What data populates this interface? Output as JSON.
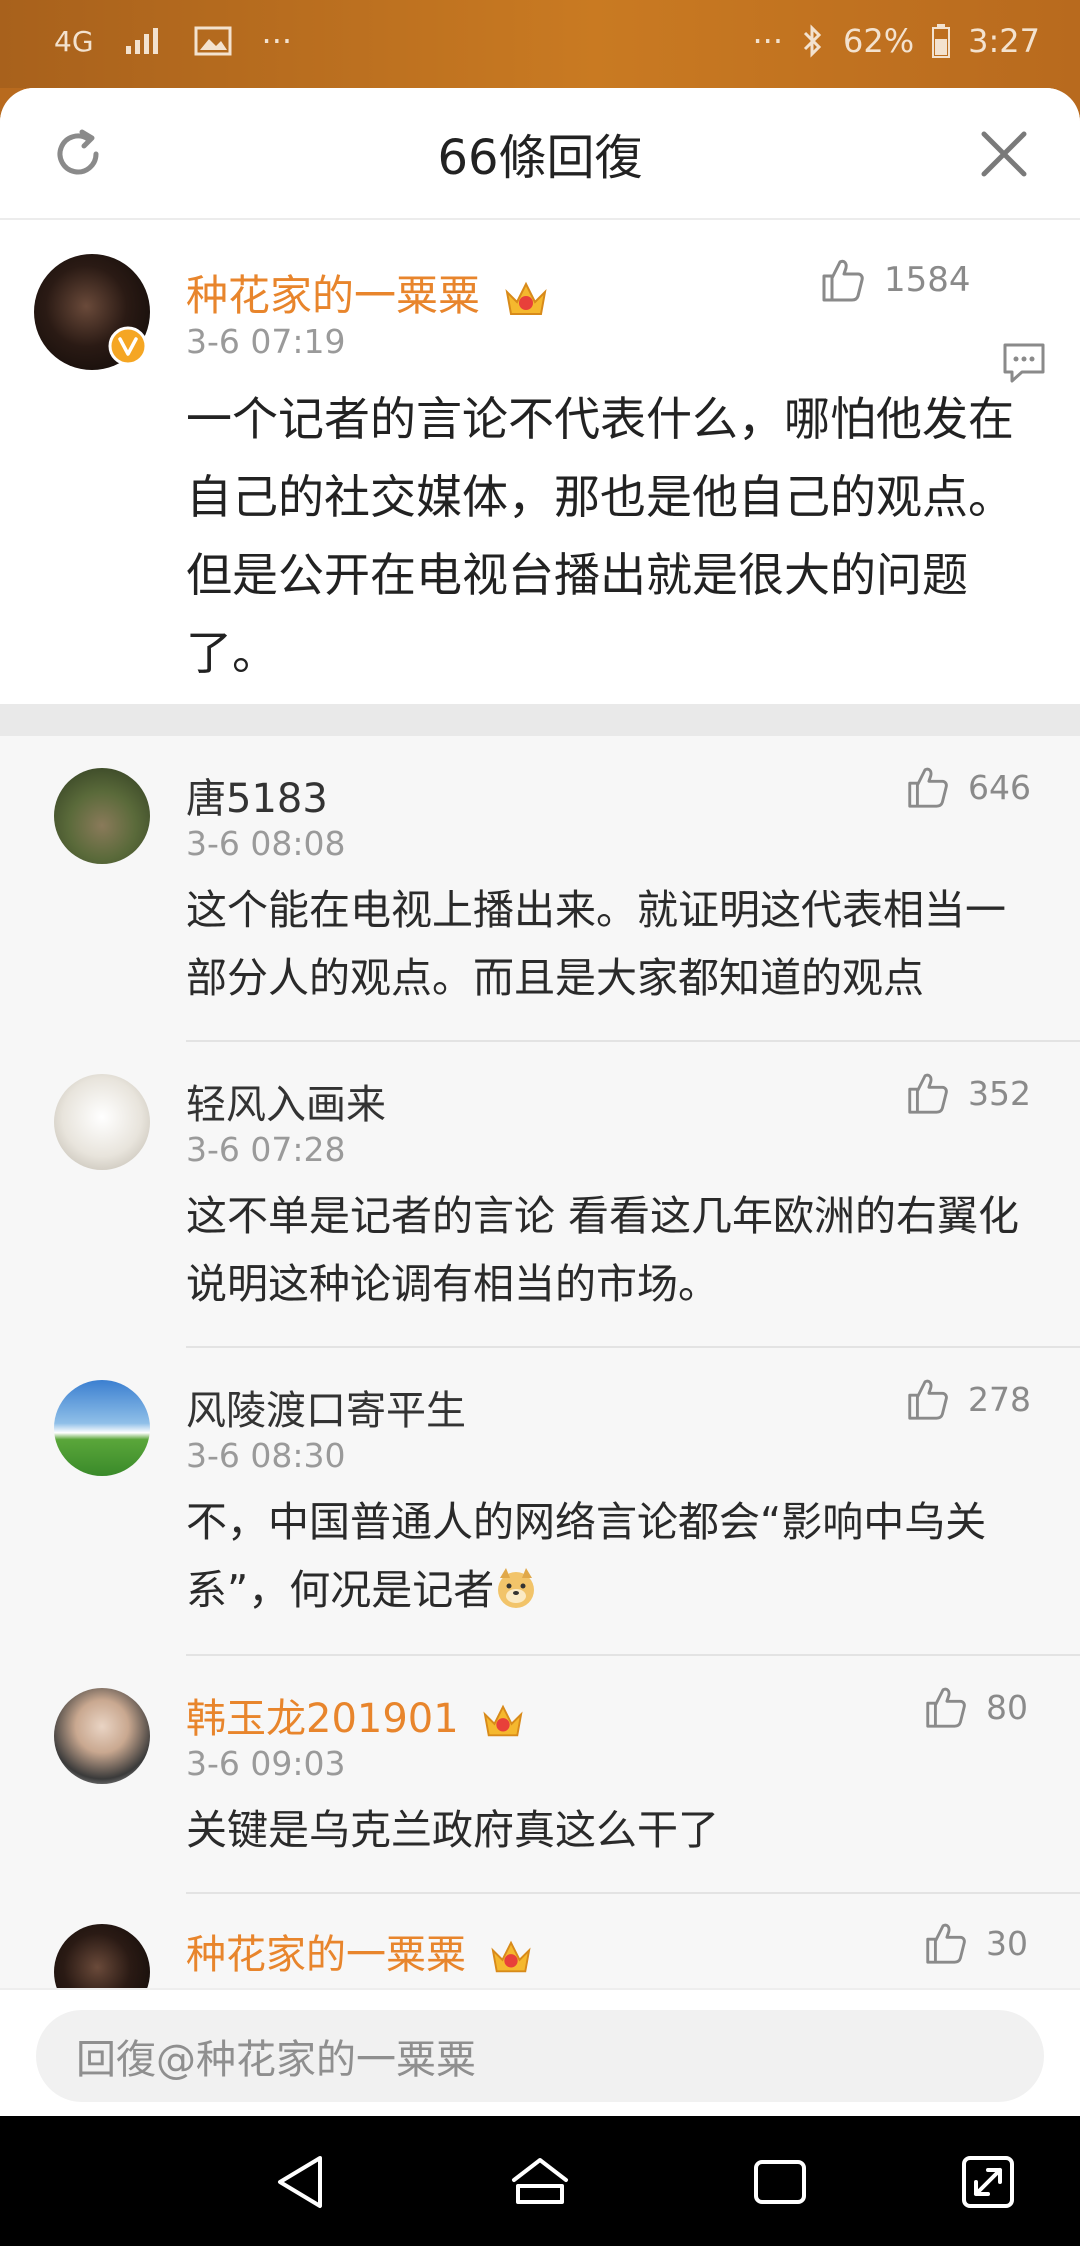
{
  "status_bar": {
    "network": "4G",
    "dots_left": "···",
    "dots_right": "···",
    "battery": "62%",
    "time": "3:27"
  },
  "header": {
    "title": "66條回復"
  },
  "root_comment": {
    "username": "种花家的一粟粟",
    "timestamp": "3-6 07:19",
    "likes": "1584",
    "content": "一个记者的言论不代表什么，哪怕他发在自己的社交媒体，那也是他自己的观点。但是公开在电视台播出就是很大的问题了。"
  },
  "replies": [
    {
      "username": "唐5183",
      "timestamp": "3-6 08:08",
      "likes": "646",
      "content": "这个能在电视上播出来。就证明这代表相当一部分人的观点。而且是大家都知道的观点"
    },
    {
      "username": "轻风入画来",
      "timestamp": "3-6 07:28",
      "likes": "352",
      "content": "这不单是记者的言论 看看这几年欧洲的右翼化 说明这种论调有相当的市场。"
    },
    {
      "username": "风陵渡口寄平生",
      "timestamp": "3-6 08:30",
      "likes": "278",
      "content": "不，中国普通人的网络言论都会“影响中乌关系”，何况是记者"
    },
    {
      "username": "韩玉龙201901",
      "timestamp": "3-6 09:03",
      "likes": "80",
      "content": "关键是乌克兰政府真这么干了"
    },
    {
      "username": "种花家的一粟粟",
      "timestamp": "",
      "likes": "30",
      "content": ""
    }
  ],
  "reply_bar": {
    "placeholder": "回復@种花家的一粟粟"
  },
  "colors": {
    "accent_orange": "#e8852c",
    "verified_badge": "#f5a623"
  }
}
